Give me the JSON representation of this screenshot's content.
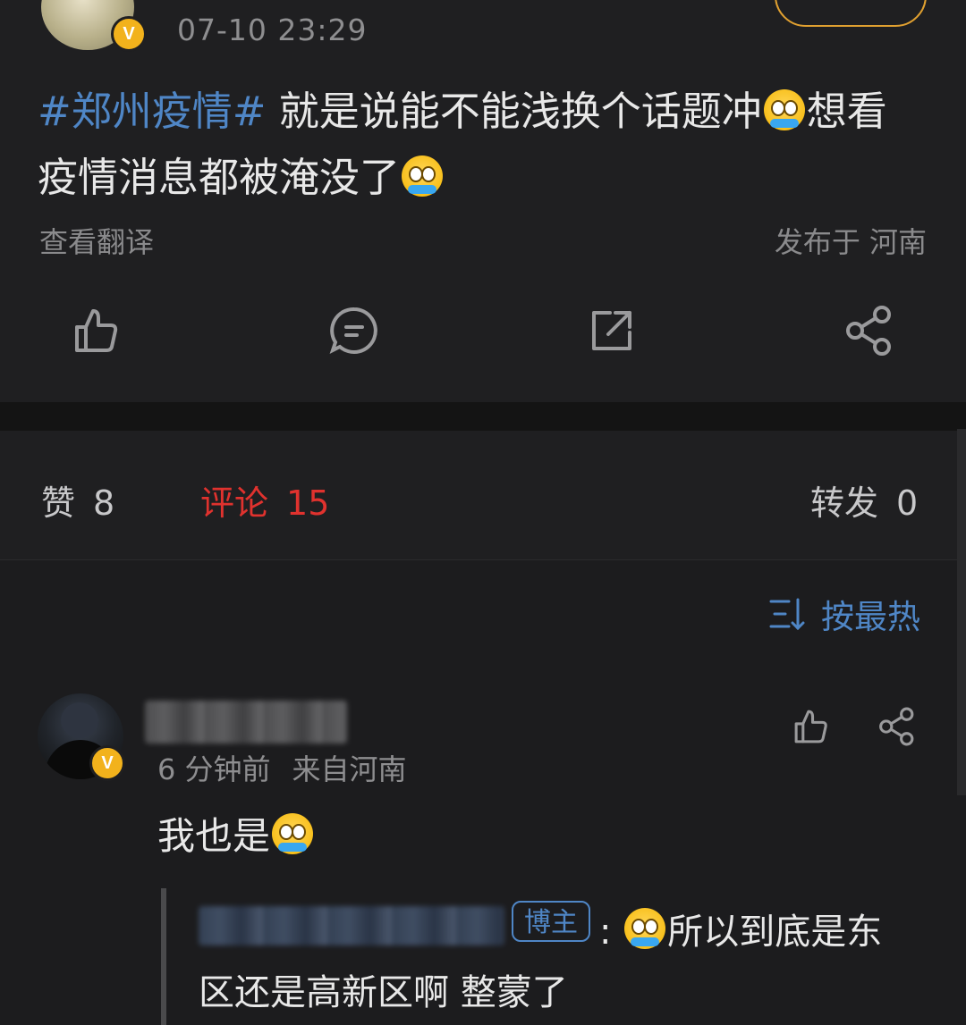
{
  "post": {
    "time": "07-10 23:29",
    "hashtag": "#郑州疫情#",
    "text_line1": " 就是说能不能浅换个话题冲",
    "text_line1_tail": "想看",
    "text_line2": "疫情消息都被淹没了",
    "translate_label": "查看翻译",
    "location": "发布于 河南",
    "verified_badge": "V"
  },
  "stats": {
    "likes_label": "赞",
    "likes_count": "8",
    "comments_label": "评论",
    "comments_count": "15",
    "reposts_label": "转发",
    "reposts_count": "0"
  },
  "sort": {
    "label": "按最热"
  },
  "comment": {
    "time": "6 分钟前",
    "source": "来自河南",
    "text": "我也是",
    "verified_badge": "V",
    "reply": {
      "author_badge": "博主",
      "colon": ":",
      "line1": "所以到底是东",
      "line2": "区还是高新区啊 整蒙了"
    }
  },
  "colors": {
    "accent_blue": "#4f86c6",
    "active_red": "#e0322e",
    "badge_gold": "#f2b21c"
  },
  "icons": [
    "like-icon",
    "comment-icon",
    "repost-icon",
    "share-icon",
    "sort-icon",
    "crying-emoji-icon"
  ]
}
